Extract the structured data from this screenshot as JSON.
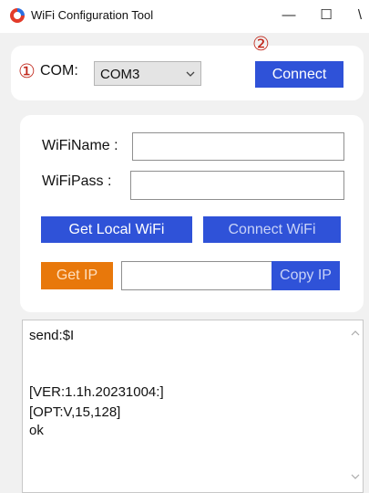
{
  "window": {
    "title": "WiFi Configuration Tool",
    "controls": {
      "minimize": "—",
      "maximize": "☐",
      "close": "\\"
    }
  },
  "annotations": {
    "first": "①",
    "second": "②"
  },
  "com": {
    "label": "COM:",
    "selected": "COM3",
    "connect_label": "Connect"
  },
  "wifi": {
    "name_label": "WiFiName :",
    "name_value": "",
    "pass_label": "WiFiPass :",
    "pass_value": "",
    "get_local_label": "Get Local WiFi",
    "connect_wifi_label": "Connect WiFi",
    "get_ip_label": "Get IP",
    "ip_value": "",
    "copy_ip_label": "Copy IP"
  },
  "console": {
    "lines": [
      "send:$I",
      "",
      "",
      "[VER:1.1h.20231004:]",
      "[OPT:V,15,128]",
      "ok"
    ]
  },
  "colors": {
    "primary_button": "#2f52d8",
    "orange_button": "#e8780b",
    "annotation": "#c0271b"
  }
}
